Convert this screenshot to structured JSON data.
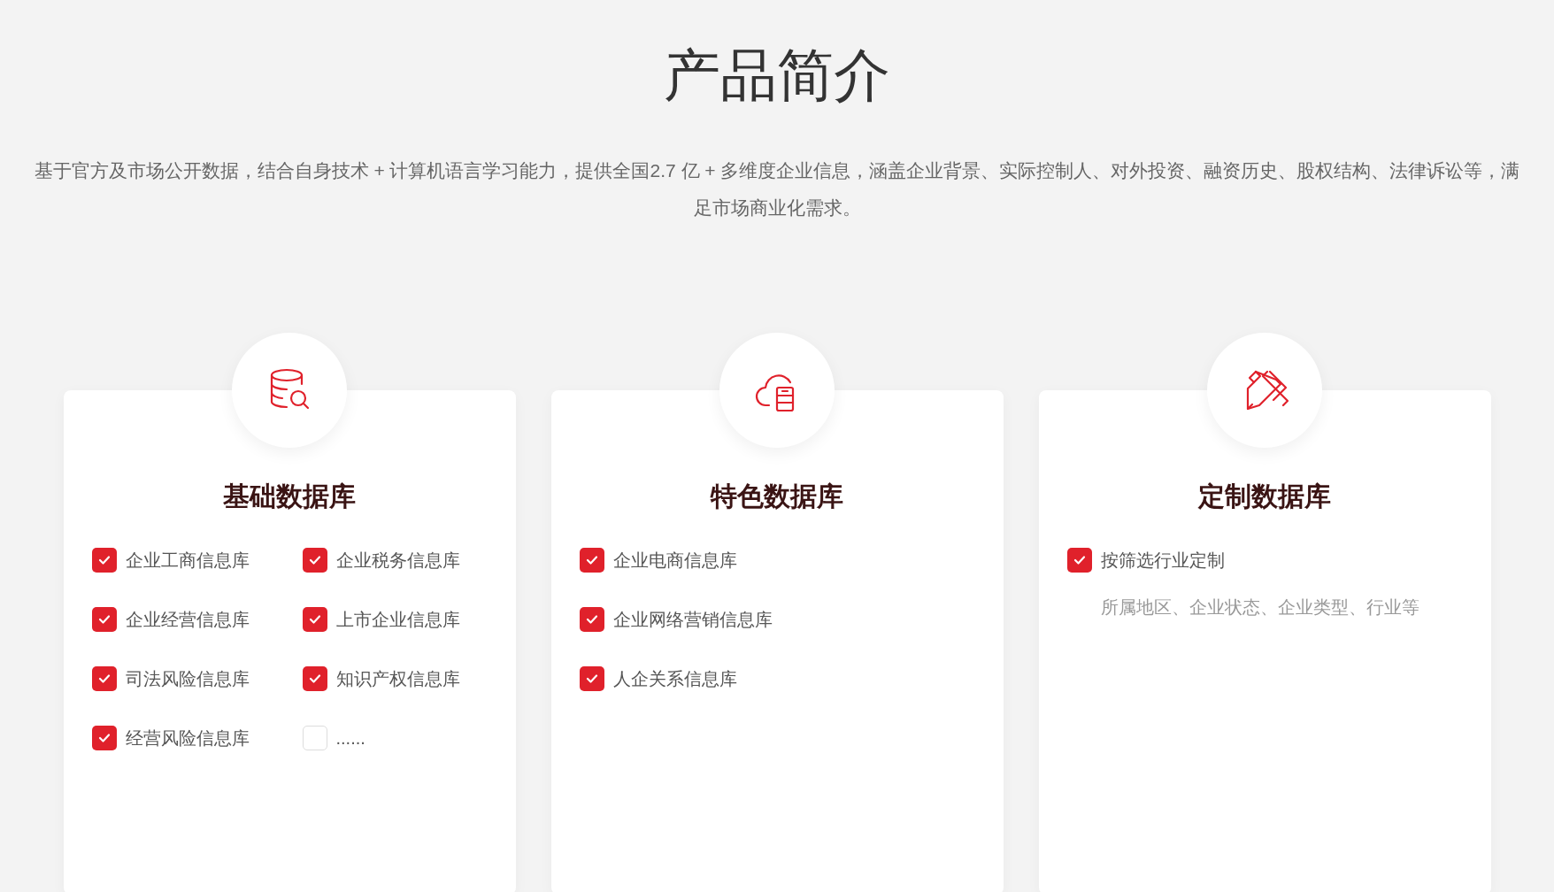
{
  "title": "产品简介",
  "description": "基于官方及市场公开数据，结合自身技术 + 计算机语言学习能力，提供全国2.7 亿 + 多维度企业信息，涵盖企业背景、实际控制人、对外投资、融资历史、股权结构、法律诉讼等，满足市场商业化需求。",
  "cards": [
    {
      "kind": "database",
      "title": "基础数据库",
      "columns": [
        [
          {
            "label": "企业工商信息库",
            "checked": true
          },
          {
            "label": "企业经营信息库",
            "checked": true
          },
          {
            "label": "司法风险信息库",
            "checked": true
          },
          {
            "label": "经营风险信息库",
            "checked": true
          }
        ],
        [
          {
            "label": "企业税务信息库",
            "checked": true
          },
          {
            "label": "上市企业信息库",
            "checked": true
          },
          {
            "label": "知识产权信息库",
            "checked": true
          },
          {
            "label": "......",
            "checked": false
          }
        ]
      ]
    },
    {
      "kind": "cloud",
      "title": "特色数据库",
      "columns": [
        [
          {
            "label": "企业电商信息库",
            "checked": true
          },
          {
            "label": "企业网络营销信息库",
            "checked": true
          },
          {
            "label": "人企关系信息库",
            "checked": true
          }
        ]
      ]
    },
    {
      "kind": "tools",
      "title": "定制数据库",
      "columns": [
        [
          {
            "label": "按筛选行业定制",
            "checked": true
          }
        ]
      ],
      "note": "所属地区、企业状态、企业类型、行业等"
    }
  ]
}
